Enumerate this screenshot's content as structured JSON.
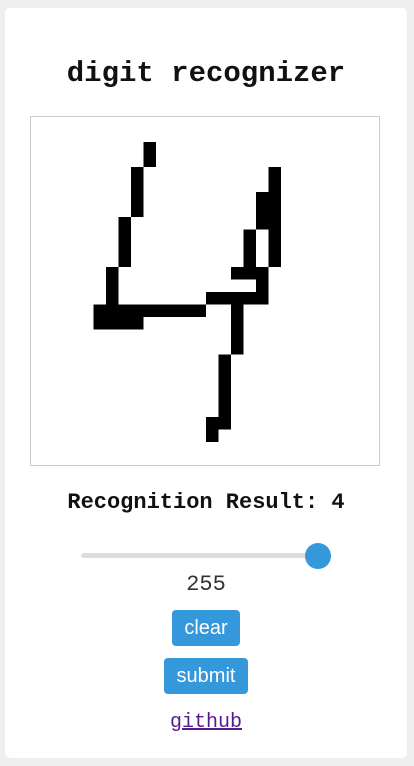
{
  "title": "digit recognizer",
  "canvas": {
    "pixel_color": "#000000",
    "grid_cells": 28
  },
  "result": {
    "text": "Recognition Result: 4"
  },
  "slider": {
    "value": "255",
    "min": 0,
    "max": 255,
    "accent_color": "#3498db"
  },
  "buttons": {
    "clear": "clear",
    "submit": "submit"
  },
  "link": {
    "label": "github"
  }
}
